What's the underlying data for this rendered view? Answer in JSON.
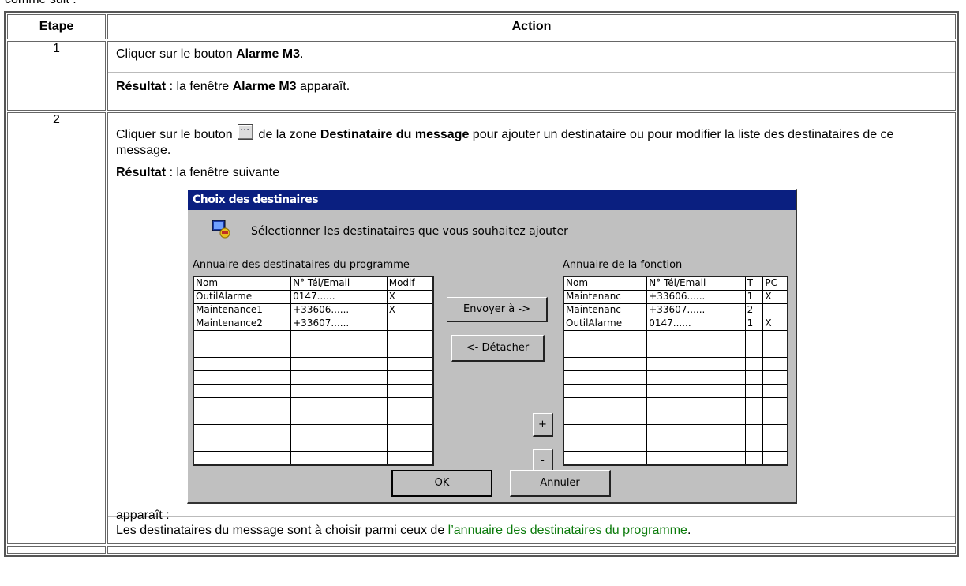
{
  "top_fragment": "comme suit :",
  "header": {
    "step": "Etape",
    "action": "Action"
  },
  "row1": {
    "step": "1",
    "l1_pre": "Cliquer sur le bouton ",
    "l1_b": "Alarme M3",
    "l1_post": ".",
    "l2_b1": "Résultat",
    "l2_mid": " : la fenêtre ",
    "l2_b2": "Alarme M3",
    "l2_post": " apparaît."
  },
  "row2": {
    "step": "2",
    "l1_pre": "Cliquer sur le bouton ",
    "l1_mid": " de la zone ",
    "l1_b": "Destinataire du message",
    "l1_post": " pour ajouter un destinataire ou pour modifier la liste des destinataires de ce message.",
    "l2_b": "Résultat",
    "l2_post": " : la fenêtre suivante",
    "l3": "apparaît :",
    "l4_pre": "Les destinataires du message sont à choisir parmi ceux de ",
    "l4_link": "l’annuaire des destinataires du programme",
    "l4_post": "."
  },
  "dialog": {
    "title": "Choix des destinaires",
    "prompt": "Sélectionner les destinataires que vous souhaitez ajouter",
    "left_label": "Annuaire des destinataires du programme",
    "right_label": "Annuaire de la fonction",
    "left_headers": [
      "Nom",
      "N° Tél/Email",
      "Modif"
    ],
    "left_rows": [
      [
        "OutilAlarme",
        "0147......",
        "X"
      ],
      [
        "Maintenance1",
        "+33606......",
        "X"
      ],
      [
        "Maintenance2",
        "+33607......",
        ""
      ]
    ],
    "right_headers": [
      "Nom",
      "N° Tél/Email",
      "T",
      "PC"
    ],
    "right_rows": [
      [
        "Maintenanc",
        "+33606......",
        "1",
        "X"
      ],
      [
        "Maintenanc",
        "+33607......",
        "2",
        ""
      ],
      [
        "OutilAlarme",
        "0147......",
        "1",
        "X"
      ]
    ],
    "btn_envoyer": "Envoyer à ->",
    "btn_detacher": "<- Détacher",
    "btn_plus": "+",
    "btn_minus": "-",
    "btn_ok": "OK",
    "btn_annuler": "Annuler"
  }
}
